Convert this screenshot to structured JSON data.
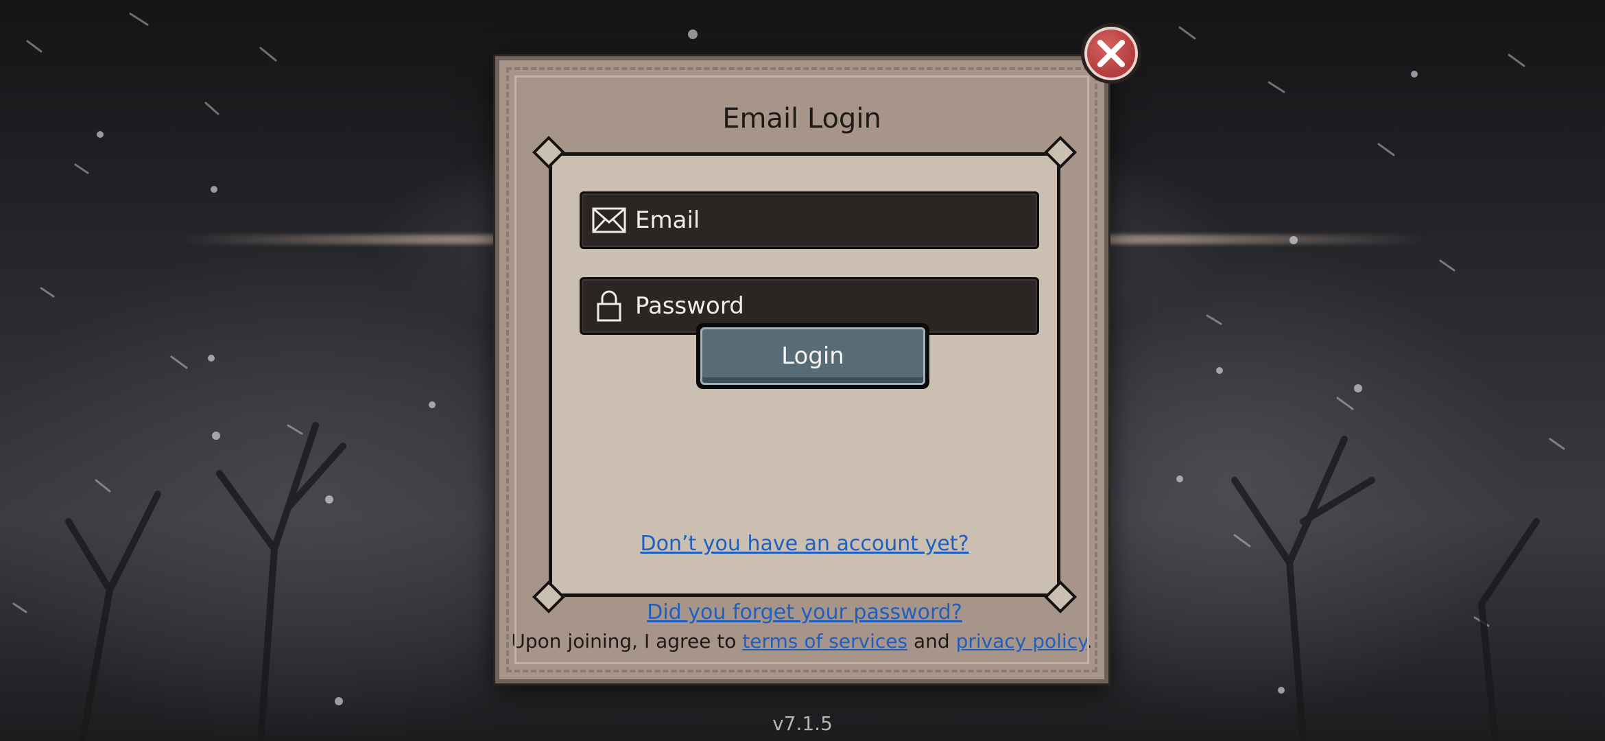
{
  "dialog": {
    "title": "Email Login",
    "email": {
      "placeholder": "Email",
      "icon": "envelope-icon"
    },
    "password": {
      "placeholder": "Password",
      "icon": "lock-icon"
    },
    "login_label": "Login",
    "signup_link": "Don’t you have an account yet?",
    "forgot_link": "Did you forget your password?",
    "terms": {
      "prefix": "Upon joining, I agree to",
      "terms_link": "terms of services",
      "and": "and",
      "privacy_link": "privacy policy",
      "suffix": "."
    },
    "close_icon": "close-icon"
  },
  "version": "v7.1.5",
  "colors": {
    "panel": "#a8958a",
    "inner_panel": "#cbbfb1",
    "field": "#2b2624",
    "button": "#586c78",
    "link": "#1f5fbf",
    "close": "#b23d3e"
  }
}
